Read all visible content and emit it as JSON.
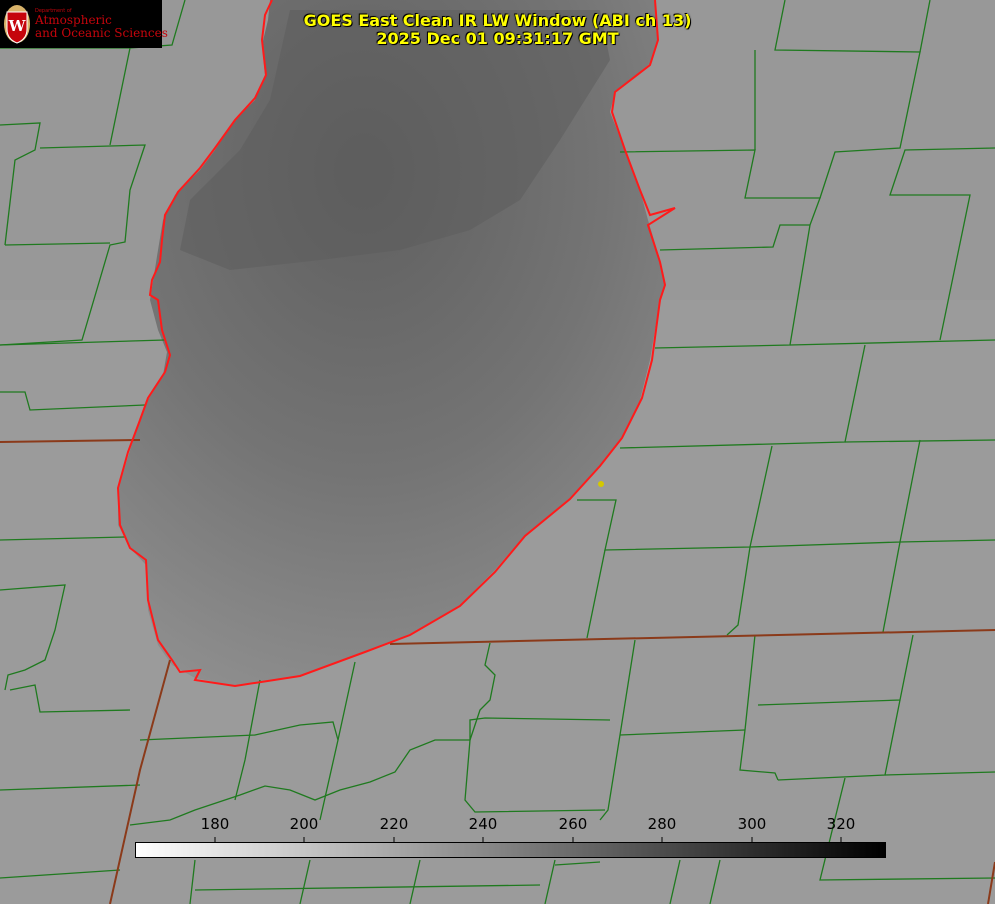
{
  "title": {
    "line1": "GOES East Clean IR LW Window (ABI ch 13)",
    "line2": "2025 Dec 01 09:31:17 GMT"
  },
  "logo": {
    "dept_small": "Department of",
    "line1": "Atmospheric",
    "line2": "and Oceanic Sciences",
    "shield_letter": "W"
  },
  "colorbar": {
    "tick_labels": [
      "180",
      "200",
      "220",
      "240",
      "260",
      "280",
      "300",
      "320"
    ],
    "min": 162,
    "max": 330,
    "gradient": "white-to-black"
  },
  "colors": {
    "county_lines": "#1f7a1f",
    "state_lines": "#8b3a1a",
    "shoreline": "#ff1a1a",
    "title": "#ffff00",
    "land": "#9a9a9a",
    "lake": "#6e6e6e"
  }
}
